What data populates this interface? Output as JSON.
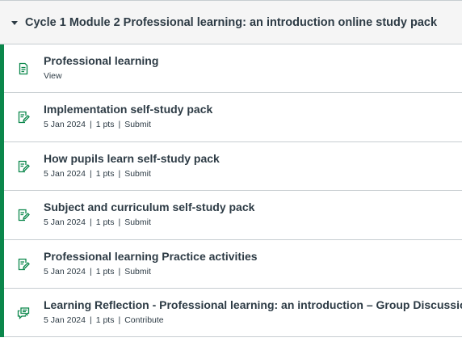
{
  "module": {
    "title": "Cycle 1 Module 2 Professional learning: an introduction online study pack",
    "accent_color": "#0b874b",
    "items": [
      {
        "icon": "page-icon",
        "title": "Professional learning",
        "action": "View"
      },
      {
        "icon": "assignment-icon",
        "title": "Implementation self-study pack",
        "date": "5 Jan 2024",
        "points": "1 pts",
        "action": "Submit"
      },
      {
        "icon": "assignment-icon",
        "title": "How pupils learn self-study pack",
        "date": "5 Jan 2024",
        "points": "1 pts",
        "action": "Submit"
      },
      {
        "icon": "assignment-icon",
        "title": "Subject and curriculum self-study pack",
        "date": "5 Jan 2024",
        "points": "1 pts",
        "action": "Submit"
      },
      {
        "icon": "assignment-icon",
        "title": "Professional learning Practice activities",
        "date": "5 Jan 2024",
        "points": "1 pts",
        "action": "Submit"
      },
      {
        "icon": "discussion-icon",
        "title": "Learning Reflection - Professional learning: an introduction – Group Discussion",
        "date": "5 Jan 2024",
        "points": "1 pts",
        "action": "Contribute"
      }
    ]
  }
}
